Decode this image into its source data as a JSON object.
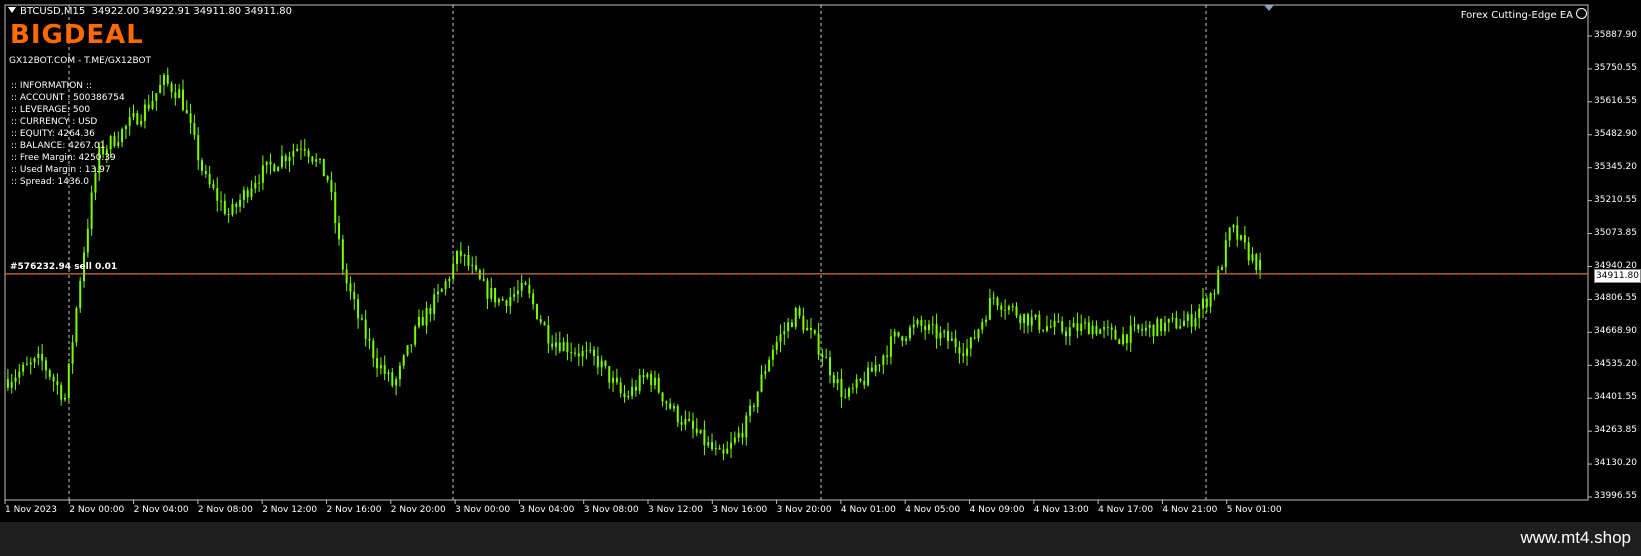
{
  "header": {
    "symbol": "BTCUSD,M15",
    "ohlc": "34922.00 34922.91 34911.80 34911.80"
  },
  "brand": "BIGDEAL",
  "site": "GX12BOT.COM - T.ME/GX12BOT",
  "info": [
    ":: INFORMATION ::",
    ":: ACCOUNT : 500386754",
    ":: LEVERAGE: 500",
    ":: CURRENCY : USD",
    ":: EQUITY: 4264.36",
    ":: BALANCE: 4267.01",
    ":: Free Margin: 4250.39",
    ":: Used Margin : 13.97",
    ":: Spread: 1436.0"
  ],
  "expert": "Forex Cutting-Edge EA",
  "order_label": "#576232.94 sell 0.01",
  "current_price": "34911.80",
  "y_axis": [
    "35887.90",
    "35750.55",
    "35616.55",
    "35482.90",
    "35345.20",
    "35210.55",
    "35073.85",
    "34940.20",
    "34806.55",
    "34668.90",
    "34535.20",
    "34401.55",
    "34263.85",
    "34130.20",
    "33996.55"
  ],
  "x_axis": [
    "1 Nov 2023",
    "2 Nov 00:00",
    "2 Nov 04:00",
    "2 Nov 08:00",
    "2 Nov 12:00",
    "2 Nov 16:00",
    "2 Nov 20:00",
    "3 Nov 00:00",
    "3 Nov 04:00",
    "3 Nov 08:00",
    "3 Nov 12:00",
    "3 Nov 16:00",
    "3 Nov 20:00",
    "4 Nov 01:00",
    "4 Nov 05:00",
    "4 Nov 09:00",
    "4 Nov 13:00",
    "4 Nov 17:00",
    "4 Nov 21:00",
    "5 Nov 01:00"
  ],
  "watermark": "www.mt4.shop",
  "colors": {
    "candle": "#7cfc00",
    "order_line": "#ff6600",
    "brand": "#ff6a00",
    "grid": "#c0c0c0"
  },
  "chart_data": {
    "type": "candlestick",
    "timeframe": "M15",
    "ylim": [
      33996.55,
      35887.9
    ],
    "close_path": [
      [
        0,
        34480
      ],
      [
        0.02,
        34560
      ],
      [
        0.035,
        34400
      ],
      [
        0.045,
        34950
      ],
      [
        0.055,
        35400
      ],
      [
        0.07,
        35500
      ],
      [
        0.085,
        35600
      ],
      [
        0.095,
        35700
      ],
      [
        0.105,
        35650
      ],
      [
        0.12,
        35300
      ],
      [
        0.135,
        35150
      ],
      [
        0.15,
        35300
      ],
      [
        0.165,
        35380
      ],
      [
        0.18,
        35450
      ],
      [
        0.195,
        35300
      ],
      [
        0.205,
        34900
      ],
      [
        0.215,
        34700
      ],
      [
        0.225,
        34550
      ],
      [
        0.235,
        34450
      ],
      [
        0.25,
        34700
      ],
      [
        0.265,
        34850
      ],
      [
        0.275,
        35000
      ],
      [
        0.29,
        34850
      ],
      [
        0.3,
        34800
      ],
      [
        0.315,
        34850
      ],
      [
        0.33,
        34650
      ],
      [
        0.345,
        34600
      ],
      [
        0.36,
        34550
      ],
      [
        0.375,
        34400
      ],
      [
        0.39,
        34500
      ],
      [
        0.405,
        34350
      ],
      [
        0.42,
        34250
      ],
      [
        0.435,
        34150
      ],
      [
        0.45,
        34300
      ],
      [
        0.465,
        34600
      ],
      [
        0.48,
        34750
      ],
      [
        0.495,
        34600
      ],
      [
        0.51,
        34400
      ],
      [
        0.525,
        34500
      ],
      [
        0.54,
        34650
      ],
      [
        0.555,
        34700
      ],
      [
        0.57,
        34650
      ],
      [
        0.585,
        34600
      ],
      [
        0.6,
        34820
      ],
      [
        0.615,
        34750
      ],
      [
        0.63,
        34700
      ],
      [
        0.645,
        34680
      ],
      [
        0.66,
        34700
      ],
      [
        0.675,
        34650
      ],
      [
        0.69,
        34680
      ],
      [
        0.705,
        34700
      ],
      [
        0.72,
        34720
      ],
      [
        0.735,
        34850
      ],
      [
        0.745,
        35100
      ],
      [
        0.755,
        35000
      ],
      [
        0.765,
        34920
      ]
    ],
    "order_price": 34911.8
  }
}
